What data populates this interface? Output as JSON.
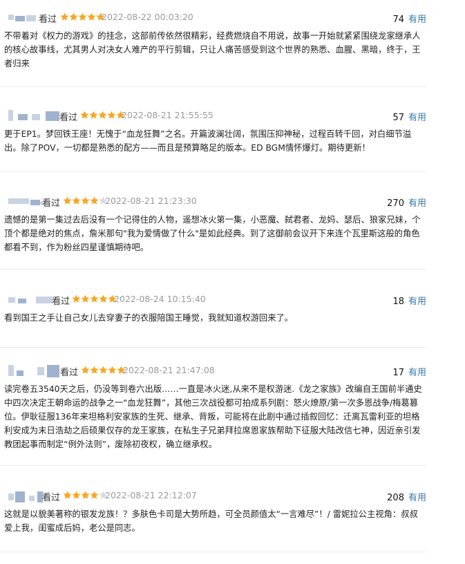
{
  "reviews": [
    {
      "watched": "看过",
      "rating": 5,
      "time": "2022-08-22 00:03:20",
      "votes": "74",
      "useful": "有用",
      "text": "不带着对《权力的游戏》的挂念，这部前传依然很精彩，经费燃烧自不用说，故事一开始就紧紧围绕龙家继承人的核心故事线，尤其男人对决女人难产的平行剪辑，只让人痛苦感受到这个世界的熟悉、血腥、黑暗，终于，王者归来"
    },
    {
      "watched": "看过",
      "rating": 5,
      "time": "2022-08-21 21:55:55",
      "votes": "57",
      "useful": "有用",
      "text": "更于EP1。梦回铁王座！无愧于“血龙狂舞”之名。开篇波澜壮阔，氛围压抑神秘，过程百转千回，对白细节溢出。除了POV，一切都是熟悉的配方——而且是预算略足的版本。ED BGM情怀爆灯。期待更新！"
    },
    {
      "watched": "看过",
      "rating": 4,
      "time": "2022-08-21 21:23:30",
      "votes": "270",
      "useful": "有用",
      "text": "遗憾的是第一集过去后没有一个记得住的人物，遥想冰火第一集，小恶魔、弑君者、龙妈、瑟后、狼家兄妹，个顶个都是绝对的焦点，詹米那句\"我为爱情做了什么\"是如此经典。到了这御前会议开下来连个瓦里斯这般的角色都看不到，作为粉丝四星谨慎期待吧。"
    },
    {
      "watched": "看过",
      "rating": 5,
      "time": "2022-08-24 10:15:40",
      "votes": "18",
      "useful": "有用",
      "text": "看到国王之手让自己女儿去穿妻子的衣服陪国王睡觉，我就知道权游回来了。"
    },
    {
      "watched": "看过",
      "rating": 5,
      "time": "2022-08-21 21:47:08",
      "votes": "17",
      "useful": "有用",
      "text": "读完卷五3540天之后，仍没等到卷六出版……一直是冰火迷,从来不是权游迷.《龙之家族》改编自王国前半通史中四次决定王朝命运的战争之一“血龙狂舞”，其他三次战役都可拍成系列剧：怒火燎原/第一次多恩战争/梅葛篡位。伊耿征服136年来坦格利安家族的生死、继承、背叛，可能将在此剧中通过插叙回忆：迁离瓦雷利亚的坦格利安成为末日浩劫之后硕果仅存的龙王家族，在私生子兄弟拜拉席恩家族帮助下征服大陆改信七神，因近亲引发教团起事而制定“例外法则”，废除初夜权，确立继承权。"
    },
    {
      "watched": "看过",
      "rating": 4,
      "time": "2022-08-21 22:12:07",
      "votes": "208",
      "useful": "有用",
      "text": "这就是以貌美著称的银发龙族！？多肤色卡司是大势所趋，可全员颜值太“一言难尽”！/ 雷妮拉公主视角：叔叔爱上我，闺蜜成后妈，老公是同志。"
    }
  ],
  "colors": {
    "star_on": "#f5a623",
    "star_off": "#d9d9d9",
    "link": "#3377aa",
    "time": "#999999"
  }
}
